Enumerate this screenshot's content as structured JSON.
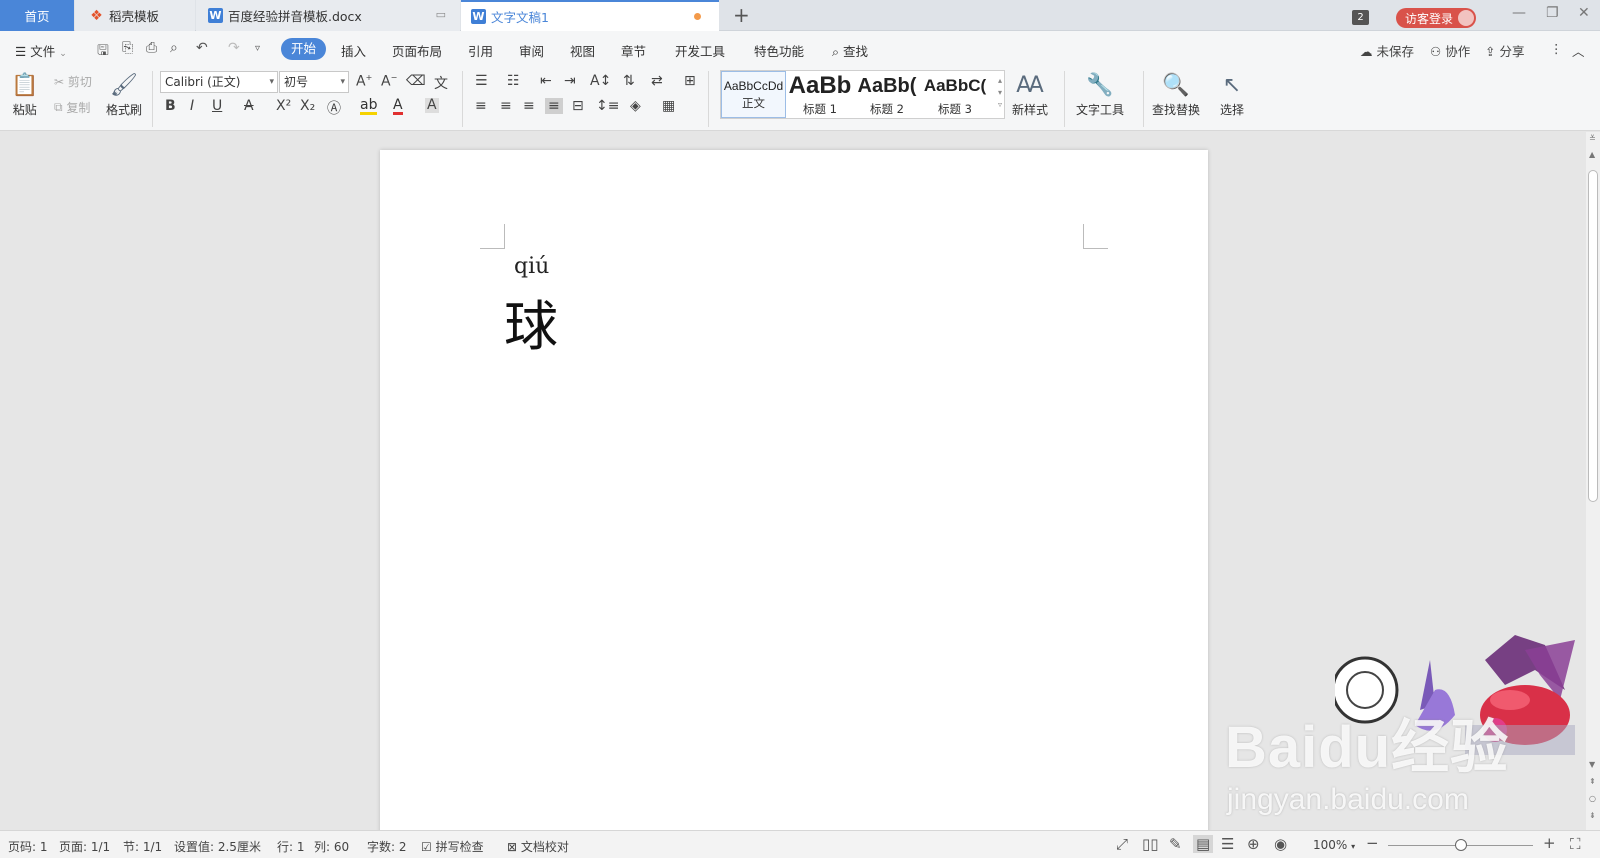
{
  "tabs": {
    "home": "首页",
    "template": "稻壳模板",
    "doc1": "百度经验拼音模板.docx",
    "doc2": "文字文稿1",
    "new_tab": "+"
  },
  "window": {
    "badge_count": "2",
    "login": "访客登录",
    "minimize": "—",
    "restore": "❐",
    "close": "✕"
  },
  "menu": {
    "file": "文件",
    "items": [
      "开始",
      "插入",
      "页面布局",
      "引用",
      "审阅",
      "视图",
      "章节",
      "开发工具",
      "特色功能"
    ],
    "search": "查找",
    "unsaved": "未保存",
    "collab": "协作",
    "share": "分享"
  },
  "toolbar": {
    "paste": "粘贴",
    "cut": "剪切",
    "copy": "复制",
    "format_painter": "格式刷",
    "font_name": "Calibri (正文)",
    "font_size": "初号",
    "new_style": "新样式",
    "text_tools": "文字工具",
    "find_replace": "查找替换",
    "select": "选择"
  },
  "styles": [
    {
      "sample": "AaBbCcDd",
      "name": "正文"
    },
    {
      "sample": "AaBb",
      "name": "标题 1"
    },
    {
      "sample": "AaBb(",
      "name": "标题 2"
    },
    {
      "sample": "AaBbC(",
      "name": "标题 3"
    }
  ],
  "document": {
    "pinyin": "qiú",
    "character": "球"
  },
  "watermark": {
    "logo": "Baidu经验",
    "url": "jingyan.baidu.com"
  },
  "status": {
    "page": "页码: 1",
    "pages": "页面: 1/1",
    "section": "节: 1/1",
    "setting": "设置值: 2.5厘米",
    "row": "行: 1",
    "col": "列: 60",
    "words": "字数: 2",
    "spellcheck": "拼写检查",
    "doc_check": "文档校对",
    "zoom": "100%"
  },
  "colors": {
    "accent": "#4a86d8",
    "login_red": "#d9524a",
    "modified_dot": "#f39a4a"
  }
}
